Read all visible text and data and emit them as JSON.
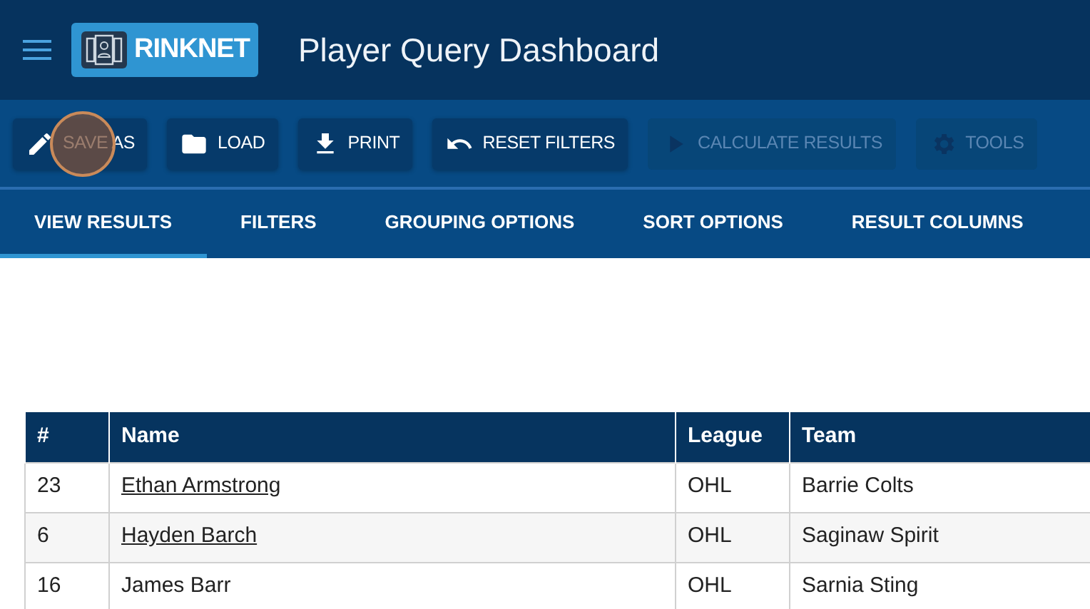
{
  "header": {
    "logo_text": "RINKNET",
    "title": "Player Query Dashboard"
  },
  "toolbar": [
    {
      "kind": "pencil",
      "label": "SAVE AS",
      "disabled": false,
      "clicked": true
    },
    {
      "kind": "folder",
      "label": "LOAD",
      "disabled": false,
      "clicked": false
    },
    {
      "kind": "download",
      "label": "PRINT",
      "disabled": false,
      "clicked": false
    },
    {
      "kind": "undo",
      "label": "RESET FILTERS",
      "disabled": false,
      "clicked": false
    },
    {
      "kind": "play",
      "label": "CALCULATE RESULTS",
      "disabled": true,
      "clicked": false
    },
    {
      "kind": "gear",
      "label": "TOOLS",
      "disabled": true,
      "clicked": false
    }
  ],
  "tabs": [
    {
      "label": "VIEW RESULTS",
      "selected": true
    },
    {
      "label": "FILTERS",
      "selected": false
    },
    {
      "label": "GROUPING OPTIONS",
      "selected": false
    },
    {
      "label": "SORT OPTIONS",
      "selected": false
    },
    {
      "label": "RESULT COLUMNS",
      "selected": false
    }
  ],
  "table": {
    "columns": [
      "#",
      "Name",
      "League",
      "Team"
    ],
    "rows": [
      {
        "cells": [
          "23",
          "Ethan Armstrong",
          "OHL",
          "Barrie Colts"
        ],
        "link": true
      },
      {
        "cells": [
          "6",
          "Hayden Barch",
          "OHL",
          "Saginaw Spirit"
        ],
        "link": true
      },
      {
        "cells": [
          "16",
          "James Barr",
          "OHL",
          "Sarnia Sting"
        ],
        "link": false
      }
    ]
  }
}
